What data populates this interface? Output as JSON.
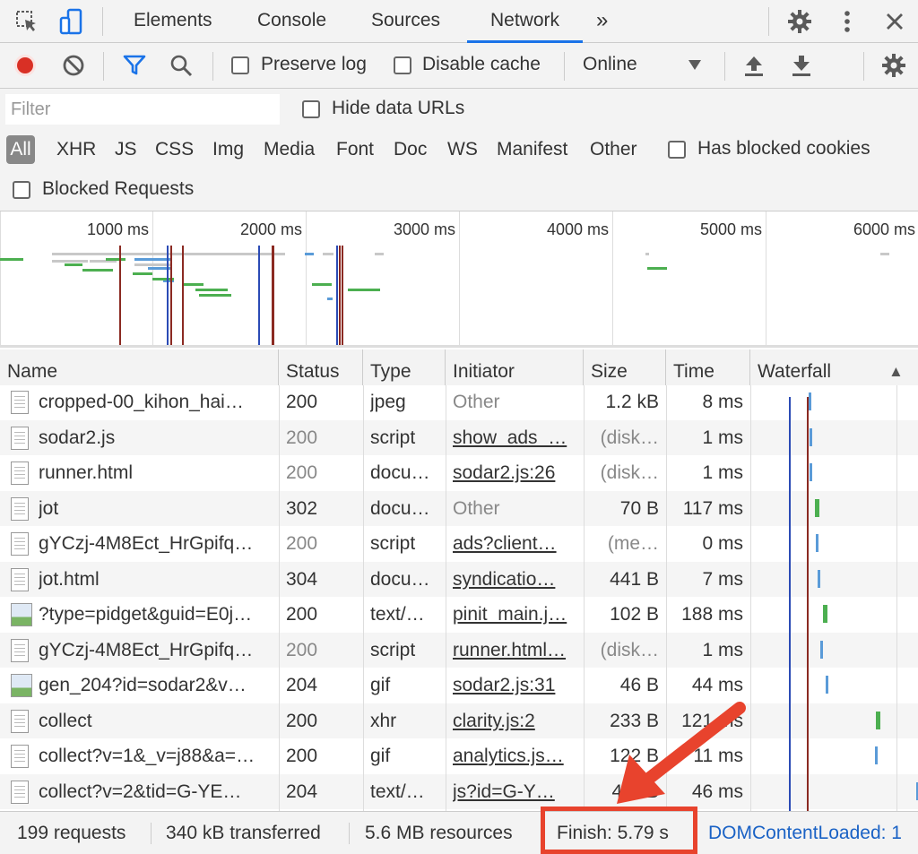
{
  "topbar": {
    "tabs": [
      "Elements",
      "Console",
      "Sources",
      "Network"
    ],
    "more": "»",
    "active_tab": "Network"
  },
  "toolbar": {
    "preserve_log": "Preserve log",
    "disable_cache": "Disable cache",
    "throttle": "Online"
  },
  "filter": {
    "placeholder": "Filter",
    "hide_data_urls": "Hide data URLs",
    "types": [
      "All",
      "XHR",
      "JS",
      "CSS",
      "Img",
      "Media",
      "Font",
      "Doc",
      "WS",
      "Manifest",
      "Other"
    ],
    "has_blocked_cookies": "Has blocked cookies",
    "blocked_requests": "Blocked Requests"
  },
  "overview": {
    "labels": [
      "1000 ms",
      "2000 ms",
      "3000 ms",
      "4000 ms",
      "5000 ms",
      "6000 ms"
    ]
  },
  "table": {
    "headers": [
      "Name",
      "Status",
      "Type",
      "Initiator",
      "Size",
      "Time",
      "Waterfall"
    ],
    "sort_icon": "▲",
    "rows": [
      {
        "name": "cropped-00_kihon_hai…",
        "status": "200",
        "type": "jpeg",
        "initiator": "Other",
        "size": "1.2 kB",
        "time": "8 ms"
      },
      {
        "name": "sodar2.js",
        "status": "200",
        "type": "script",
        "initiator": "show_ads_…",
        "size": "(disk…",
        "time": "1 ms"
      },
      {
        "name": "runner.html",
        "status": "200",
        "type": "docu…",
        "initiator": "sodar2.js:26",
        "size": "(disk…",
        "time": "1 ms"
      },
      {
        "name": "jot",
        "status": "302",
        "type": "docu…",
        "initiator": "Other",
        "size": "70 B",
        "time": "117 ms"
      },
      {
        "name": "gYCzj-4M8Ect_HrGpifq…",
        "status": "200",
        "type": "script",
        "initiator": "ads?client…",
        "size": "(me…",
        "time": "0 ms"
      },
      {
        "name": "jot.html",
        "status": "304",
        "type": "docu…",
        "initiator": "syndicatio…",
        "size": "441 B",
        "time": "7 ms"
      },
      {
        "name": "?type=pidget&guid=E0j…",
        "status": "200",
        "type": "text/…",
        "initiator": "pinit_main.j…",
        "size": "102 B",
        "time": "188 ms"
      },
      {
        "name": "gYCzj-4M8Ect_HrGpifq…",
        "status": "200",
        "type": "script",
        "initiator": "runner.html…",
        "size": "(disk…",
        "time": "1 ms"
      },
      {
        "name": "gen_204?id=sodar2&v…",
        "status": "204",
        "type": "gif",
        "initiator": "sodar2.js:31",
        "size": "46 B",
        "time": "44 ms"
      },
      {
        "name": "collect",
        "status": "200",
        "type": "xhr",
        "initiator": "clarity.js:2",
        "size": "233 B",
        "time": "121 ms"
      },
      {
        "name": "collect?v=1&_v=j88&a=…",
        "status": "200",
        "type": "gif",
        "initiator": "analytics.js…",
        "size": "122 B",
        "time": "11 ms"
      },
      {
        "name": "collect?v=2&tid=G-YE…",
        "status": "204",
        "type": "text/…",
        "initiator": "js?id=G-Y…",
        "size": "4… B",
        "time": "46 ms"
      }
    ]
  },
  "status": {
    "requests": "199 requests",
    "transferred": "340 kB transferred",
    "resources": "5.6 MB resources",
    "finish": "Finish: 5.79 s",
    "dom_loaded": "DOMContentLoaded: 1"
  },
  "colors": {
    "accent": "#1a73e8",
    "record": "#d93025",
    "highlight": "#e8432d",
    "dom_link": "#1a62c5"
  }
}
